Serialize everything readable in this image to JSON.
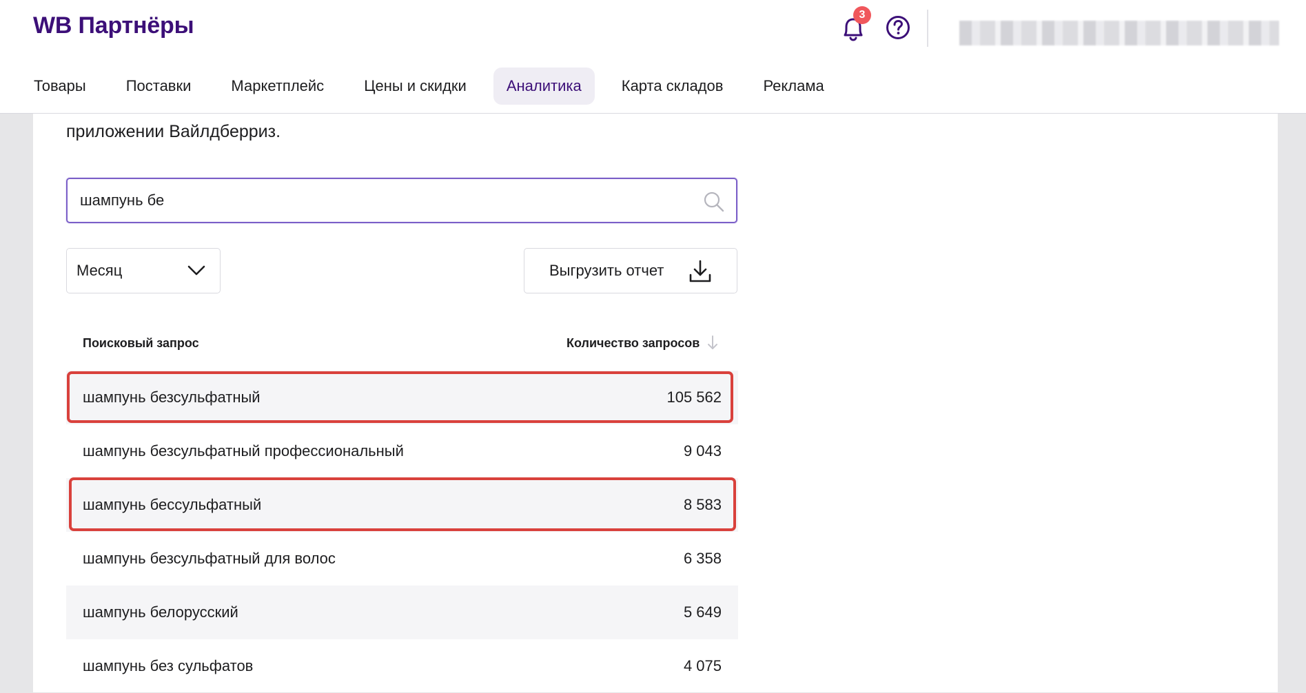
{
  "header": {
    "logo": "WB Партнёры",
    "notifications_count": "3",
    "user_name": "(blurred)"
  },
  "nav": {
    "items": [
      {
        "label": "Товары"
      },
      {
        "label": "Поставки"
      },
      {
        "label": "Маркетплейс"
      },
      {
        "label": "Цены и скидки"
      },
      {
        "label": "Аналитика",
        "active": true
      },
      {
        "label": "Карта складов"
      },
      {
        "label": "Реклама"
      }
    ]
  },
  "main": {
    "description": "приложении Вайлдберриз.",
    "search": {
      "value": "шампунь бе"
    },
    "period": {
      "selected": "Месяц"
    },
    "export_label": "Выгрузить отчет",
    "table": {
      "headers": {
        "query": "Поисковый запрос",
        "count": "Количество запросов"
      },
      "rows": [
        {
          "query": "шампунь безсульфатный",
          "count": "105 562",
          "highlighted": true
        },
        {
          "query": "шампунь безсульфатный профессиональный",
          "count": "9 043",
          "highlighted": false
        },
        {
          "query": "шампунь бессульфатный",
          "count": "8 583",
          "highlighted": true
        },
        {
          "query": "шампунь безсульфатный для волос",
          "count": "6 358",
          "highlighted": false
        },
        {
          "query": "шампунь белорусский",
          "count": "5 649",
          "highlighted": false
        },
        {
          "query": "шампунь без сульфатов",
          "count": "4 075",
          "highlighted": false
        }
      ]
    }
  },
  "colors": {
    "brand": "#3c0f78",
    "highlight": "#d9413c",
    "badge": "#f0575c",
    "search_border": "#7b5fc8"
  }
}
